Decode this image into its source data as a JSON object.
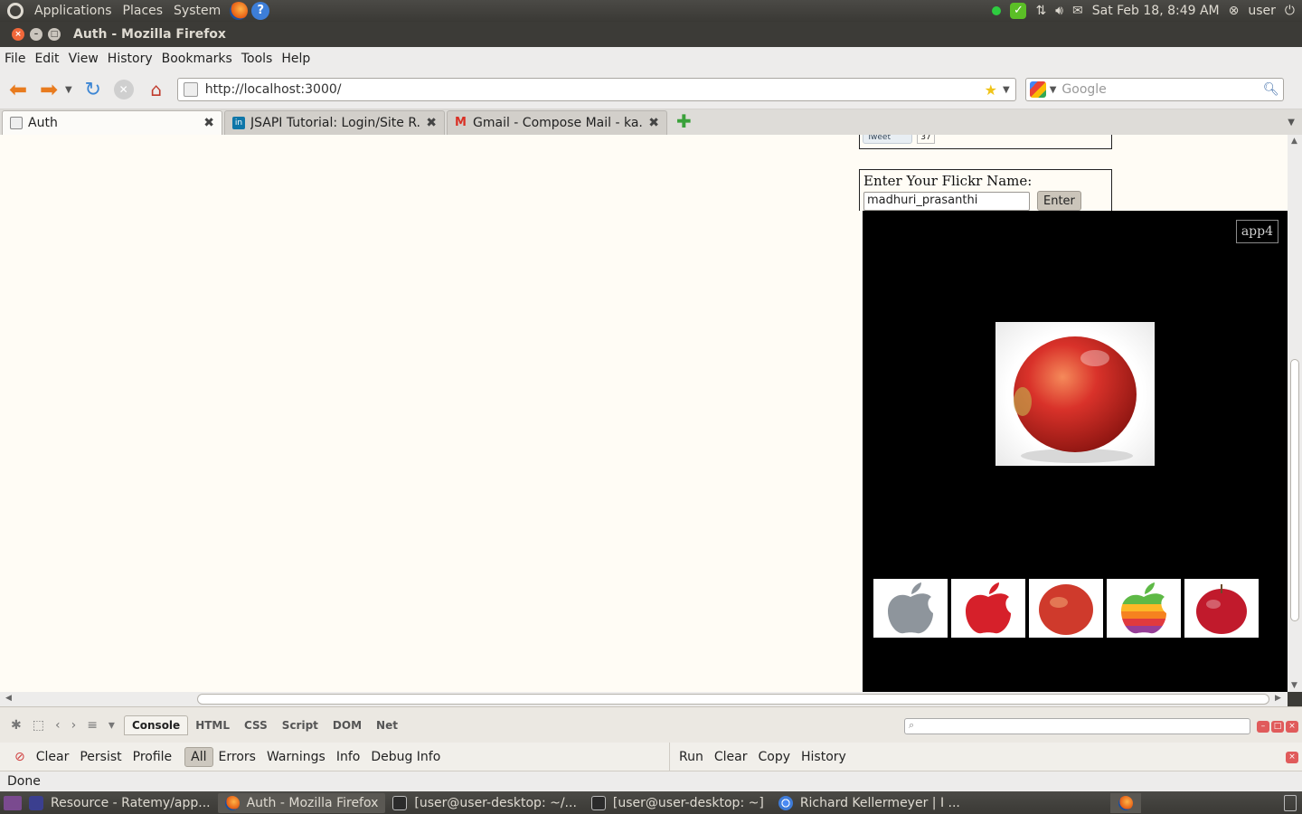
{
  "top_panel": {
    "menus": [
      "Applications",
      "Places",
      "System"
    ],
    "datetime": "Sat Feb 18,  8:49 AM",
    "user": "user"
  },
  "window": {
    "title": "Auth - Mozilla Firefox"
  },
  "menubar": [
    "File",
    "Edit",
    "View",
    "History",
    "Bookmarks",
    "Tools",
    "Help"
  ],
  "navbar": {
    "url": "http://localhost:3000/",
    "search_placeholder": "Google"
  },
  "tabs": [
    {
      "label": "Auth",
      "active": true
    },
    {
      "label": "JSAPI Tutorial: Login/Site R...",
      "active": false
    },
    {
      "label": "Gmail - Compose Mail - ka...",
      "active": false
    }
  ],
  "page": {
    "tweet_label": "Tweet",
    "tweet_count": "37",
    "flickr_prompt": "Enter Your Flickr Name:",
    "flickr_value": "madhuri_prasanthi",
    "enter_label": "Enter",
    "app_badge": "app4"
  },
  "firebug": {
    "tabs": [
      "Console",
      "HTML",
      "CSS",
      "Script",
      "DOM",
      "Net"
    ],
    "console_buttons": [
      "Clear",
      "Persist",
      "Profile"
    ],
    "filters": [
      "All",
      "Errors",
      "Warnings",
      "Info",
      "Debug Info"
    ],
    "cmd_buttons": [
      "Run",
      "Clear",
      "Copy",
      "History"
    ]
  },
  "status": "Done",
  "taskbar": [
    {
      "label": "Resource - Ratemy/app...",
      "active": false
    },
    {
      "label": "Auth - Mozilla Firefox",
      "active": true
    },
    {
      "label": "[user@user-desktop: ~/...",
      "active": false
    },
    {
      "label": "[user@user-desktop: ~]",
      "active": false
    },
    {
      "label": "Richard Kellermeyer | I ...",
      "active": false
    }
  ]
}
